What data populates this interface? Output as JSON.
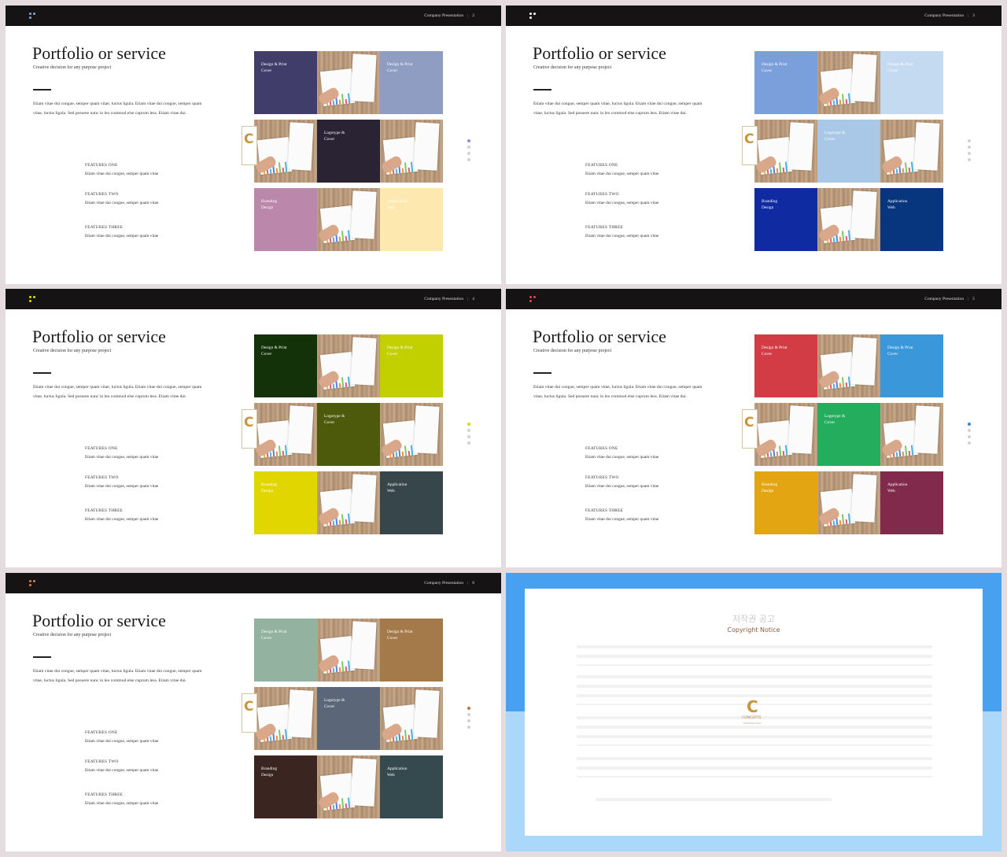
{
  "slides": [
    {
      "title": "Portfolio or service",
      "subtitle": "Creative decision for any purpose  project",
      "body": "Etiam vitae dui congue, semper quam vitae, luctus ligula. Etiam vitae dui congue, semper quam vitae, luctus ligula. Sed posuere nunc in leo commod else cuprum less. Etiam vitae dui.",
      "header_text": "Company Presentation",
      "page_number": "2",
      "features": [
        {
          "title": "FEATURES ONE",
          "desc": "Etiam vitae dui congue, semper quam vitae"
        },
        {
          "title": "FEATURES TWO",
          "desc": "Etiam vitae dui congue, semper quam vitae"
        },
        {
          "title": "FEATURES THREE",
          "desc": "Etiam vitae dui congue, semper quam vitae"
        }
      ],
      "tiles": [
        {
          "label": "Design & Print\nCover",
          "color": "#403d6a"
        },
        {
          "label": "Design & Print\nCover",
          "color": "#8f9dc2"
        },
        {
          "label": "Logotype &\nCover",
          "color": "#2a2333"
        },
        {
          "label": "Branding\nDesign",
          "color": "#bb87ab"
        },
        {
          "label": "Application\nWeb",
          "color": "#fde9af"
        }
      ],
      "logo_dot_color": "#8fa0d8",
      "pager_active_color": "#8f8fd4",
      "pager_active_index": 0
    },
    {
      "title": "Portfolio or service",
      "subtitle": "Creative decision for any purpose  project",
      "body": "Etiam vitae dui congue, semper quam vitae, luctus ligula. Etiam vitae dui congue, semper quam vitae, luctus ligula. Sed posuere nunc in leo commod else cuprum less. Etiam vitae dui.",
      "header_text": "Company Presentation",
      "page_number": "3",
      "features": [
        {
          "title": "FEATURES ONE",
          "desc": "Etiam vitae dui congue, semper quam vitae"
        },
        {
          "title": "FEATURES TWO",
          "desc": "Etiam vitae dui congue, semper quam vitae"
        },
        {
          "title": "FEATURES THREE",
          "desc": "Etiam vitae dui congue, semper quam vitae"
        }
      ],
      "tiles": [
        {
          "label": "Design & Print\nCover",
          "color": "#7a9fda"
        },
        {
          "label": "Design & Print\nCover",
          "color": "#c4daf1"
        },
        {
          "label": "Logotype &\nCover",
          "color": "#a9c8e8"
        },
        {
          "label": "Branding\nDesign",
          "color": "#102aa1"
        },
        {
          "label": "Application\nWeb",
          "color": "#07357e"
        }
      ],
      "logo_dot_color": "#ffffff",
      "pager_active_color": "#d2d2d2",
      "pager_active_index": 0
    },
    {
      "title": "Portfolio or service",
      "subtitle": "Creative decision for any purpose  project",
      "body": "Etiam vitae dui congue, semper quam vitae, luctus ligula. Etiam vitae dui congue, semper quam vitae, luctus ligula. Sed posuere nunc in leo commod else cuprum less. Etiam vitae dui.",
      "header_text": "Company Presentation",
      "page_number": "4",
      "features": [
        {
          "title": "FEATURES ONE",
          "desc": "Etiam vitae dui congue, semper quam vitae"
        },
        {
          "title": "FEATURES TWO",
          "desc": "Etiam vitae dui congue, semper quam vitae"
        },
        {
          "title": "FEATURES THREE",
          "desc": "Etiam vitae dui congue, semper quam vitae"
        }
      ],
      "tiles": [
        {
          "label": "Design & Print\nCover",
          "color": "#13320a"
        },
        {
          "label": "Design & Print\nCover",
          "color": "#c3d000"
        },
        {
          "label": "Logotype &\nCover",
          "color": "#4d5a0b"
        },
        {
          "label": "Branding\nDesign",
          "color": "#e2d600"
        },
        {
          "label": "Application\nWeb",
          "color": "#37464b"
        }
      ],
      "logo_dot_color": "#d8e000",
      "pager_active_color": "#d6dc10",
      "pager_active_index": 0
    },
    {
      "title": "Portfolio or service",
      "subtitle": "Creative decision for any purpose  project",
      "body": "Etiam vitae dui congue, semper quam vitae, luctus ligula. Etiam vitae dui congue, semper quam vitae, luctus ligula. Sed posuere nunc in leo commod else cuprum less. Etiam vitae dui.",
      "header_text": "Company Presentation",
      "page_number": "5",
      "features": [
        {
          "title": "FEATURES ONE",
          "desc": "Etiam vitae dui congue, semper quam vitae"
        },
        {
          "title": "FEATURES TWO",
          "desc": "Etiam vitae dui congue, semper quam vitae"
        },
        {
          "title": "FEATURES THREE",
          "desc": "Etiam vitae dui congue, semper quam vitae"
        }
      ],
      "tiles": [
        {
          "label": "Design & Print\nCover",
          "color": "#d33c44"
        },
        {
          "label": "Design & Print\nCover",
          "color": "#3a97da"
        },
        {
          "label": "Logotype &\nCover",
          "color": "#25ad5e"
        },
        {
          "label": "Branding\nDesign",
          "color": "#e3a612"
        },
        {
          "label": "Application\nWeb",
          "color": "#822a4c"
        }
      ],
      "logo_dot_color": "#e0474e",
      "pager_active_color": "#3a88d4",
      "pager_active_index": 0
    },
    {
      "title": "Portfolio or service",
      "subtitle": "Creative decision for any purpose  project",
      "body": "Etiam vitae dui congue, semper quam vitae, luctus ligula. Etiam vitae dui congue, semper quam vitae, luctus ligula. Sed posuere nunc in leo commod else cuprum less. Etiam vitae dui.",
      "header_text": "Company Presentation",
      "page_number": "6",
      "features": [
        {
          "title": "FEATURES ONE",
          "desc": "Etiam vitae dui congue, semper quam vitae"
        },
        {
          "title": "FEATURES TWO",
          "desc": "Etiam vitae dui congue, semper quam vitae"
        },
        {
          "title": "FEATURES THREE",
          "desc": "Etiam vitae dui congue, semper quam vitae"
        }
      ],
      "tiles": [
        {
          "label": "Design & Print\nCover",
          "color": "#93b29f"
        },
        {
          "label": "Design & Print\nCover",
          "color": "#a57a4a"
        },
        {
          "label": "Logotype &\nCover",
          "color": "#5b6678"
        },
        {
          "label": "Branding\nDesign",
          "color": "#3a2520"
        },
        {
          "label": "Application\nWeb",
          "color": "#344a4f"
        }
      ],
      "logo_dot_color": "#c9874f",
      "pager_active_color": "#b8794a",
      "pager_active_index": 0
    }
  ],
  "copyright": {
    "title_kr": "저작권 공고",
    "title_en": "Copyright Notice",
    "logo_letter": "C",
    "logo_name": "CONCEPTS",
    "logo_tagline": "PRESENTATION"
  }
}
